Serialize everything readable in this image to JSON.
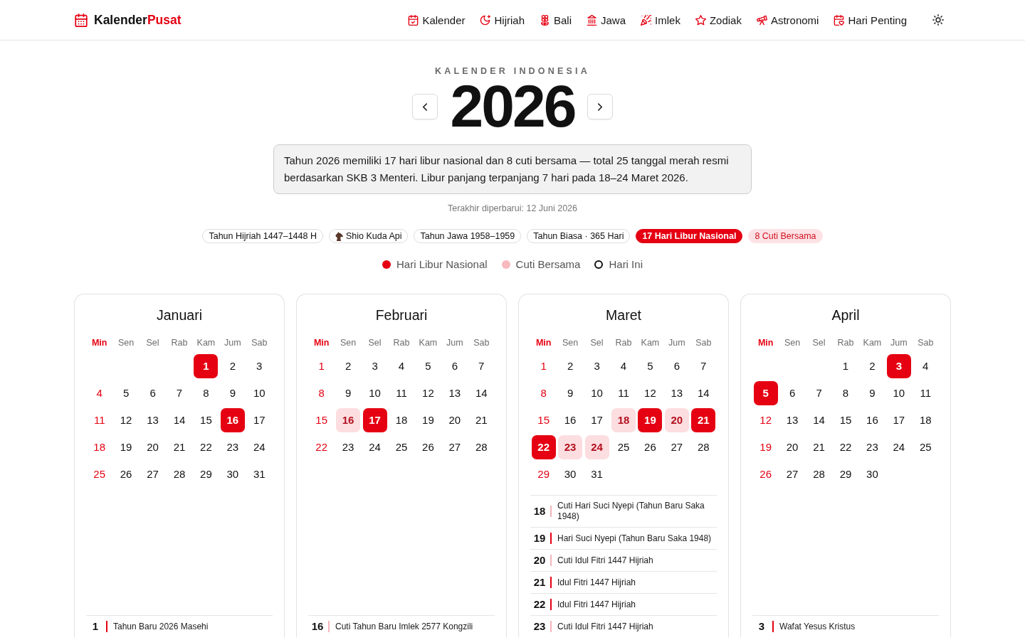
{
  "header": {
    "logo": {
      "text": "Kalender",
      "accent": "Pusat"
    },
    "nav": [
      {
        "label": "Kalender"
      },
      {
        "label": "Hijriah"
      },
      {
        "label": "Bali"
      },
      {
        "label": "Jawa"
      },
      {
        "label": "Imlek"
      },
      {
        "label": "Zodiak"
      },
      {
        "label": "Astronomi"
      },
      {
        "label": "Hari Penting"
      }
    ]
  },
  "hero": {
    "eyebrow": "KALENDER INDONESIA",
    "year": "2026",
    "summary": "Tahun 2026 memiliki 17 hari libur nasional dan 8 cuti bersama — total 25 tanggal merah resmi berdasarkan SKB 3 Menteri. Libur panjang terpanjang 7 hari pada 18–24 Maret 2026.",
    "updated": "Terakhir diperbarui: 12 Juni 2026",
    "chips": [
      {
        "label": "Tahun Hijriah 1447–1448 H",
        "kind": "plain"
      },
      {
        "label": "Shio Kuda Api",
        "kind": "zodiac"
      },
      {
        "label": "Tahun Jawa 1958–1959",
        "kind": "plain"
      },
      {
        "label": "Tahun Biasa · 365 Hari",
        "kind": "plain"
      },
      {
        "label": "17 Hari Libur Nasional",
        "kind": "holiday"
      },
      {
        "label": "8 Cuti Bersama",
        "kind": "cuti"
      }
    ],
    "legend": [
      {
        "label": "Hari Libur Nasional",
        "kind": "dot",
        "color": "#e50012"
      },
      {
        "label": "Cuti Bersama",
        "kind": "dot",
        "color": "#f7b8be"
      },
      {
        "label": "Hari Ini",
        "kind": "ring",
        "color": "#111111"
      }
    ]
  },
  "months": [
    {
      "name": "Januari",
      "weekdays": [
        "Min",
        "Sen",
        "Sel",
        "Rab",
        "Kam",
        "Jum",
        "Sab"
      ],
      "weeks": [
        [
          {
            "day": "1",
            "kind": "holiday"
          },
          {
            "day": "2",
            "kind": "normal"
          },
          {
            "day": "3",
            "kind": "normal"
          }
        ],
        [
          {
            "day": "4",
            "kind": "normal"
          },
          {
            "day": "5",
            "kind": "normal"
          },
          {
            "day": "6",
            "kind": "normal"
          },
          {
            "day": "7",
            "kind": "normal"
          },
          {
            "day": "8",
            "kind": "normal"
          },
          {
            "day": "9",
            "kind": "normal"
          },
          {
            "day": "10",
            "kind": "normal"
          }
        ],
        [
          {
            "day": "11",
            "kind": "normal"
          },
          {
            "day": "12",
            "kind": "normal"
          },
          {
            "day": "13",
            "kind": "normal"
          },
          {
            "day": "14",
            "kind": "normal"
          },
          {
            "day": "15",
            "kind": "normal"
          },
          {
            "day": "16",
            "kind": "holiday"
          },
          {
            "day": "17",
            "kind": "normal"
          }
        ],
        [
          {
            "day": "18",
            "kind": "normal"
          },
          {
            "day": "19",
            "kind": "normal"
          },
          {
            "day": "20",
            "kind": "normal"
          },
          {
            "day": "21",
            "kind": "normal"
          },
          {
            "day": "22",
            "kind": "normal"
          },
          {
            "day": "23",
            "kind": "normal"
          },
          {
            "day": "24",
            "kind": "normal"
          }
        ],
        [
          {
            "day": "25",
            "kind": "normal"
          },
          {
            "day": "26",
            "kind": "normal"
          },
          {
            "day": "27",
            "kind": "normal"
          },
          {
            "day": "28",
            "kind": "normal"
          },
          {
            "day": "29",
            "kind": "normal"
          },
          {
            "day": "30",
            "kind": "normal"
          },
          {
            "day": "31",
            "kind": "normal"
          }
        ]
      ],
      "events": [
        {
          "date": "1",
          "title": "Tahun Baru 2026 Masehi",
          "kind": "holiday"
        }
      ]
    },
    {
      "name": "Februari",
      "weekdays": [
        "Min",
        "Sen",
        "Sel",
        "Rab",
        "Kam",
        "Jum",
        "Sab"
      ],
      "weeks": [
        [
          {
            "day": "1",
            "kind": "normal"
          },
          {
            "day": "2",
            "kind": "normal"
          },
          {
            "day": "3",
            "kind": "normal"
          },
          {
            "day": "4",
            "kind": "normal"
          },
          {
            "day": "5",
            "kind": "normal"
          },
          {
            "day": "6",
            "kind": "normal"
          },
          {
            "day": "7",
            "kind": "normal"
          }
        ],
        [
          {
            "day": "8",
            "kind": "normal"
          },
          {
            "day": "9",
            "kind": "normal"
          },
          {
            "day": "10",
            "kind": "normal"
          },
          {
            "day": "11",
            "kind": "normal"
          },
          {
            "day": "12",
            "kind": "normal"
          },
          {
            "day": "13",
            "kind": "normal"
          },
          {
            "day": "14",
            "kind": "normal"
          }
        ],
        [
          {
            "day": "15",
            "kind": "normal"
          },
          {
            "day": "16",
            "kind": "cuti"
          },
          {
            "day": "17",
            "kind": "holiday"
          },
          {
            "day": "18",
            "kind": "normal"
          },
          {
            "day": "19",
            "kind": "normal"
          },
          {
            "day": "20",
            "kind": "normal"
          },
          {
            "day": "21",
            "kind": "normal"
          }
        ],
        [
          {
            "day": "22",
            "kind": "normal"
          },
          {
            "day": "23",
            "kind": "normal"
          },
          {
            "day": "24",
            "kind": "normal"
          },
          {
            "day": "25",
            "kind": "normal"
          },
          {
            "day": "26",
            "kind": "normal"
          },
          {
            "day": "27",
            "kind": "normal"
          },
          {
            "day": "28",
            "kind": "normal"
          }
        ]
      ],
      "events": [
        {
          "date": "16",
          "title": "Cuti Tahun Baru Imlek 2577 Kongzili",
          "kind": "cuti"
        }
      ]
    },
    {
      "name": "Maret",
      "weekdays": [
        "Min",
        "Sen",
        "Sel",
        "Rab",
        "Kam",
        "Jum",
        "Sab"
      ],
      "weeks": [
        [
          {
            "day": "1",
            "kind": "normal"
          },
          {
            "day": "2",
            "kind": "normal"
          },
          {
            "day": "3",
            "kind": "normal"
          },
          {
            "day": "4",
            "kind": "normal"
          },
          {
            "day": "5",
            "kind": "normal"
          },
          {
            "day": "6",
            "kind": "normal"
          },
          {
            "day": "7",
            "kind": "normal"
          }
        ],
        [
          {
            "day": "8",
            "kind": "normal"
          },
          {
            "day": "9",
            "kind": "normal"
          },
          {
            "day": "10",
            "kind": "normal"
          },
          {
            "day": "11",
            "kind": "normal"
          },
          {
            "day": "12",
            "kind": "normal"
          },
          {
            "day": "13",
            "kind": "normal"
          },
          {
            "day": "14",
            "kind": "normal"
          }
        ],
        [
          {
            "day": "15",
            "kind": "normal"
          },
          {
            "day": "16",
            "kind": "normal"
          },
          {
            "day": "17",
            "kind": "normal"
          },
          {
            "day": "18",
            "kind": "cuti"
          },
          {
            "day": "19",
            "kind": "holiday"
          },
          {
            "day": "20",
            "kind": "cuti"
          },
          {
            "day": "21",
            "kind": "holiday"
          }
        ],
        [
          {
            "day": "22",
            "kind": "holiday"
          },
          {
            "day": "23",
            "kind": "cuti"
          },
          {
            "day": "24",
            "kind": "cuti"
          },
          {
            "day": "25",
            "kind": "normal"
          },
          {
            "day": "26",
            "kind": "normal"
          },
          {
            "day": "27",
            "kind": "normal"
          },
          {
            "day": "28",
            "kind": "normal"
          }
        ],
        [
          {
            "day": "29",
            "kind": "normal"
          },
          {
            "day": "30",
            "kind": "normal"
          },
          {
            "day": "31",
            "kind": "normal"
          }
        ]
      ],
      "events": [
        {
          "date": "18",
          "title": "Cuti Hari Suci Nyepi (Tahun Baru Saka 1948)",
          "kind": "cuti"
        },
        {
          "date": "19",
          "title": "Hari Suci Nyepi (Tahun Baru Saka 1948)",
          "kind": "holiday"
        },
        {
          "date": "20",
          "title": "Cuti Idul Fitri 1447 Hijriah",
          "kind": "cuti"
        },
        {
          "date": "21",
          "title": "Idul Fitri 1447 Hijriah",
          "kind": "holiday"
        },
        {
          "date": "22",
          "title": "Idul Fitri 1447 Hijriah",
          "kind": "holiday"
        },
        {
          "date": "23",
          "title": "Cuti Idul Fitri 1447 Hijriah",
          "kind": "cuti"
        }
      ]
    },
    {
      "name": "April",
      "weekdays": [
        "Min",
        "Sen",
        "Sel",
        "Rab",
        "Kam",
        "Jum",
        "Sab"
      ],
      "weeks": [
        [
          {
            "day": "1",
            "kind": "normal"
          },
          {
            "day": "2",
            "kind": "normal"
          },
          {
            "day": "3",
            "kind": "holiday"
          },
          {
            "day": "4",
            "kind": "normal"
          }
        ],
        [
          {
            "day": "5",
            "kind": "holiday"
          },
          {
            "day": "6",
            "kind": "normal"
          },
          {
            "day": "7",
            "kind": "normal"
          },
          {
            "day": "8",
            "kind": "normal"
          },
          {
            "day": "9",
            "kind": "normal"
          },
          {
            "day": "10",
            "kind": "normal"
          },
          {
            "day": "11",
            "kind": "normal"
          }
        ],
        [
          {
            "day": "12",
            "kind": "normal"
          },
          {
            "day": "13",
            "kind": "normal"
          },
          {
            "day": "14",
            "kind": "normal"
          },
          {
            "day": "15",
            "kind": "normal"
          },
          {
            "day": "16",
            "kind": "normal"
          },
          {
            "day": "17",
            "kind": "normal"
          },
          {
            "day": "18",
            "kind": "normal"
          }
        ],
        [
          {
            "day": "19",
            "kind": "normal"
          },
          {
            "day": "20",
            "kind": "normal"
          },
          {
            "day": "21",
            "kind": "normal"
          },
          {
            "day": "22",
            "kind": "normal"
          },
          {
            "day": "23",
            "kind": "normal"
          },
          {
            "day": "24",
            "kind": "normal"
          },
          {
            "day": "25",
            "kind": "normal"
          }
        ],
        [
          {
            "day": "26",
            "kind": "normal"
          },
          {
            "day": "27",
            "kind": "normal"
          },
          {
            "day": "28",
            "kind": "normal"
          },
          {
            "day": "29",
            "kind": "normal"
          },
          {
            "day": "30",
            "kind": "normal"
          }
        ]
      ],
      "events": [
        {
          "date": "3",
          "title": "Wafat Yesus Kristus",
          "kind": "holiday"
        }
      ]
    }
  ]
}
